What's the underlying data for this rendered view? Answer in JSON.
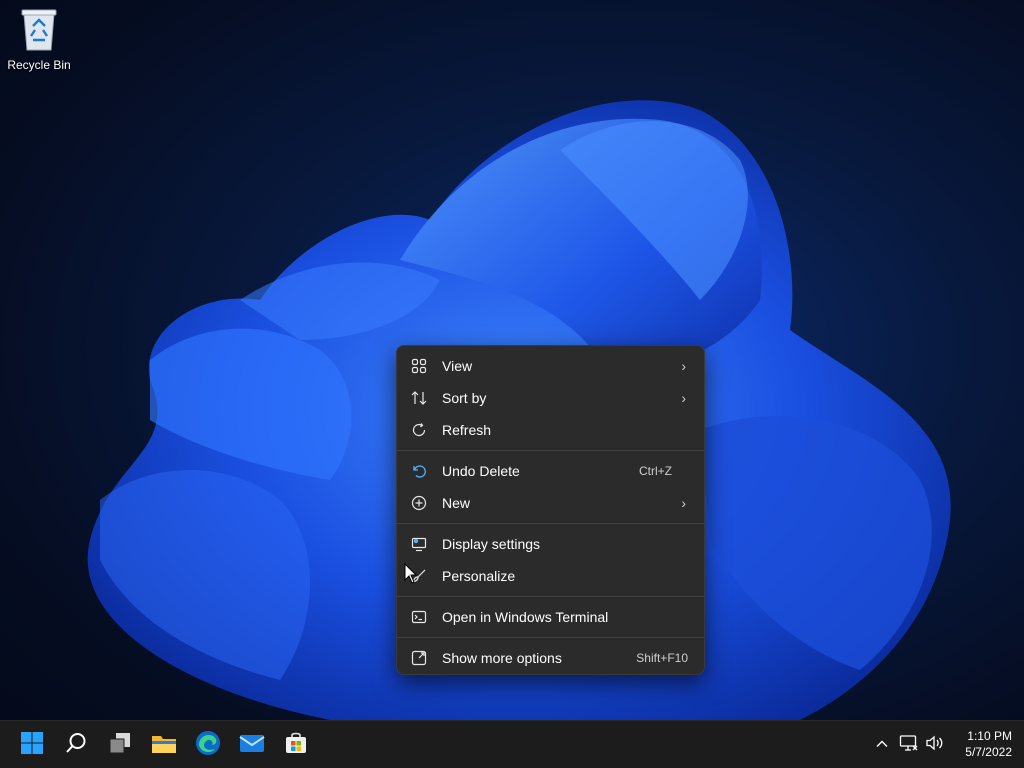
{
  "desktop": {
    "icons": [
      {
        "label": "Recycle Bin",
        "icon": "recycle-bin-icon"
      }
    ]
  },
  "context_menu": {
    "items": [
      {
        "label": "View",
        "icon": "grid-view-icon",
        "submenu": true
      },
      {
        "label": "Sort by",
        "icon": "sort-arrows-icon",
        "submenu": true
      },
      {
        "label": "Refresh",
        "icon": "refresh-icon"
      },
      {
        "label": "Undo Delete",
        "icon": "undo-icon",
        "shortcut": "Ctrl+Z"
      },
      {
        "label": "New",
        "icon": "plus-circle-icon",
        "submenu": true
      },
      {
        "label": "Display settings",
        "icon": "display-settings-icon"
      },
      {
        "label": "Personalize",
        "icon": "brush-icon"
      },
      {
        "label": "Open in Windows Terminal",
        "icon": "terminal-icon"
      },
      {
        "label": "Show more options",
        "icon": "share-expand-icon",
        "shortcut": "Shift+F10"
      }
    ],
    "chevron": "›"
  },
  "taskbar": {
    "apps": [
      "start-icon",
      "search-icon",
      "task-view-icon",
      "file-explorer-icon",
      "edge-icon",
      "mail-icon",
      "store-icon"
    ],
    "tray": [
      "chevron-up-icon",
      "network-icon",
      "volume-icon"
    ],
    "clock": {
      "time": "1:10 PM",
      "date": "5/7/2022"
    }
  },
  "colors": {
    "accent": "#1e6cff",
    "menu_bg": "#2b2b2b",
    "taskbar_bg": "#1c1c1c"
  }
}
